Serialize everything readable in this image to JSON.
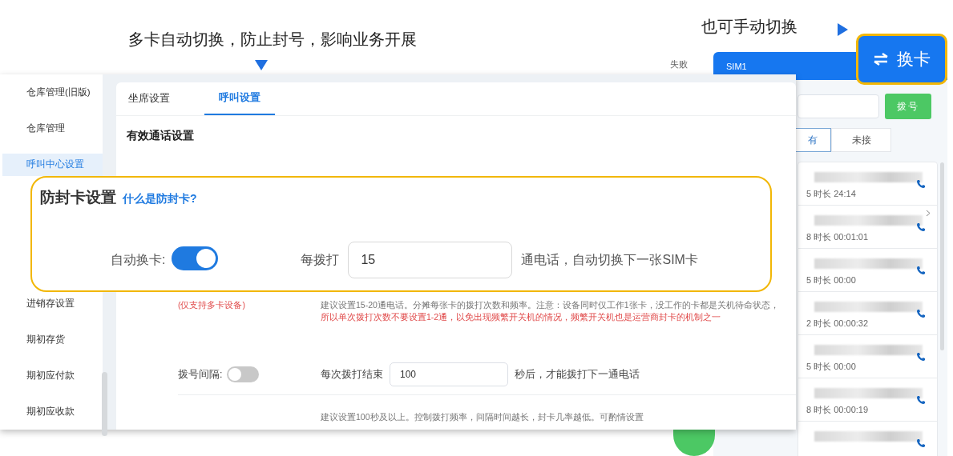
{
  "annotations": {
    "headline": "多卡自动切换，防止封号，影响业务开展",
    "manual_hint": "也可手动切换"
  },
  "switch_button": {
    "label": "换卡"
  },
  "phone_panel": {
    "status_text": "失败",
    "sim": "SIM1",
    "dial_button": "拨号",
    "tabs": [
      {
        "label": "有",
        "selected": true
      },
      {
        "label": "未接",
        "selected": false
      }
    ],
    "calls": [
      {
        "time": "5 时长 24:14",
        "expandable": false
      },
      {
        "time": "8 时长 00:01:01",
        "expandable": true
      },
      {
        "time": "5 时长 00:00",
        "expandable": false
      },
      {
        "time": "2 时长 00:00:32",
        "expandable": false
      },
      {
        "time": "5 时长 00:00",
        "expandable": false
      },
      {
        "time": "8 时长 00:00:19",
        "expandable": false
      }
    ]
  },
  "sidebar": {
    "items": [
      {
        "label": "仓库管理(旧版)",
        "selected": false
      },
      {
        "label": "仓库管理",
        "selected": false
      },
      {
        "label": "呼叫中心设置",
        "selected": true
      }
    ],
    "items_below": [
      {
        "label": "进销存设置",
        "selected": false
      },
      {
        "label": "期初存货",
        "selected": false
      },
      {
        "label": "期初应付款",
        "selected": false
      },
      {
        "label": "期初应收款",
        "selected": false
      }
    ]
  },
  "settings": {
    "tabs": [
      {
        "label": "坐席设置",
        "selected": false
      },
      {
        "label": "呼叫设置",
        "selected": true
      }
    ],
    "section_title": "有效通话设置",
    "multi_card_note": "(仅支持多卡设备)",
    "card_hint": "建议设置15-20通电话。分摊每张卡的拨打次数和频率。注意：设备同时仅工作1张卡，没工作的卡都是关机待命状态，",
    "card_warning": "所以单次拨打次数不要设置1-2通，以免出现频繁开关机的情况，频繁开关机也是运营商封卡的机制之一",
    "interval": {
      "label": "拨号间隔:",
      "on": false,
      "prefix": "每次拨打结束",
      "value": "100",
      "suffix": "秒后，才能拨打下一通电话",
      "hint": "建议设置100秒及以上。控制拨打频率，间隔时间越长，封卡几率越低。可酌情设置"
    }
  },
  "callout": {
    "title": "防封卡设置",
    "link": "什么是防封卡?",
    "label": "自动换卡:",
    "on": true,
    "prefix": "每拨打",
    "value": "15",
    "suffix": "通电话，自动切换下一张SIM卡"
  }
}
